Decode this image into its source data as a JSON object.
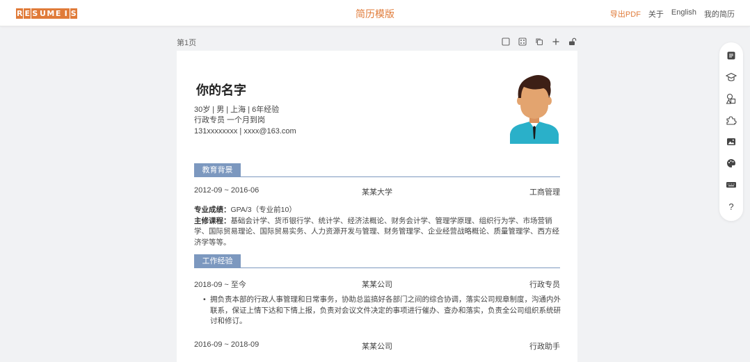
{
  "header": {
    "logo_letters": [
      "R",
      "E",
      "S",
      "U",
      "M",
      "E",
      "I",
      "S"
    ],
    "title": "简历模版",
    "nav": {
      "export_pdf": "导出PDF",
      "about": "关于",
      "english": "English",
      "my_resume": "我的简历"
    },
    "accent_color": "#e07b39"
  },
  "page": {
    "label": "第1页",
    "tools": [
      "square-icon",
      "dice-icon",
      "copy-icon",
      "plus-icon",
      "unlock-icon"
    ]
  },
  "resume": {
    "name": "你的名字",
    "info": [
      "30岁 | 男 | 上海 | 6年经验",
      "行政专员 一个月到岗",
      "131xxxxxxxx | xxxx@163.com"
    ],
    "section_color": "#7c98bf",
    "education": {
      "title": "教育背景",
      "period": "2012-09 ~ 2016-06",
      "school": "某某大学",
      "major": "工商管理",
      "score_label": "专业成绩：",
      "score_value": "GPA/3（专业前10）",
      "courses_label": "主修课程：",
      "courses_value": "基础会计学、货币银行学、统计学、经济法概论、财务会计学、管理学原理、组织行为学、市场营销学、国际贸易理论、国际贸易实务、人力资源开发与管理、财务管理学、企业经营战略概论、质量管理学、西方经济学等等。"
    },
    "work": {
      "title": "工作经验",
      "jobs": [
        {
          "period": "2018-09 ~ 至今",
          "company": "某某公司",
          "position": "行政专员",
          "bullet": "拥负责本部的行政人事管理和日常事务，协助总监搞好各部门之间的综合协调，落实公司规章制度，沟通内外联系，保证上情下达和下情上报，负责对会议文件决定的事项进行催办、查办和落实，负责全公司组织系统研讨和修订。"
        },
        {
          "period": "2016-09 ~ 2018-09",
          "company": "某某公司",
          "position": "行政助手"
        }
      ]
    }
  },
  "sidebar": {
    "items": [
      "template-list-icon",
      "education-icon",
      "shapes-icon",
      "puzzle-icon",
      "image-icon",
      "palette-icon",
      "keyboard-icon",
      "help-icon"
    ],
    "help_label": "?"
  }
}
